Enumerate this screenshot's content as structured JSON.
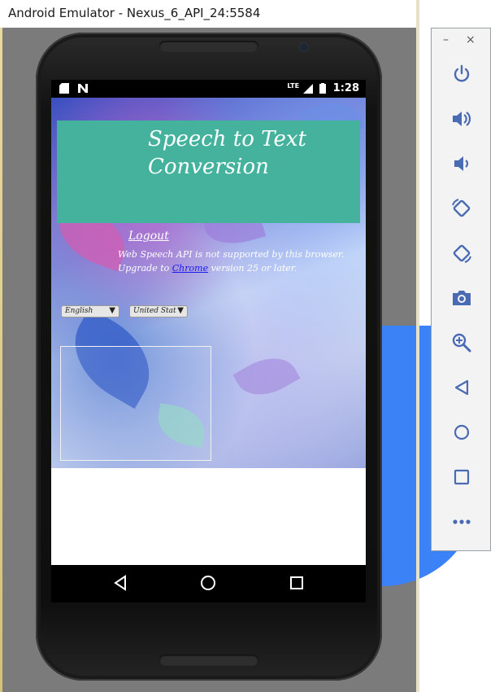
{
  "window": {
    "title": "Android Emulator - Nexus_6_API_24:5584"
  },
  "statusbar": {
    "time": "1:28",
    "network": "LTE"
  },
  "app": {
    "header_title_line1": "Speech to Text",
    "header_title_line2": "Conversion",
    "logout_label": "Logout",
    "info_line1": "Web Speech API is not supported by this browser.",
    "info_line2_prefix": "Upgrade to ",
    "info_link": "Chrome",
    "info_line2_suffix": " version 25 or later.",
    "language_select": "English",
    "dialect_select": "United Stat"
  },
  "toolbar": {
    "minimize": "–",
    "close": "×",
    "buttons": [
      "power-icon",
      "volume-up-icon",
      "volume-down-icon",
      "rotate-left-icon",
      "rotate-right-icon",
      "camera-icon",
      "zoom-icon",
      "back-icon",
      "home-icon",
      "overview-icon",
      "more-icon"
    ]
  },
  "colors": {
    "header": "#44b29c",
    "accent": "#3b82f6",
    "toolbar_icon": "#4a6bb3"
  }
}
